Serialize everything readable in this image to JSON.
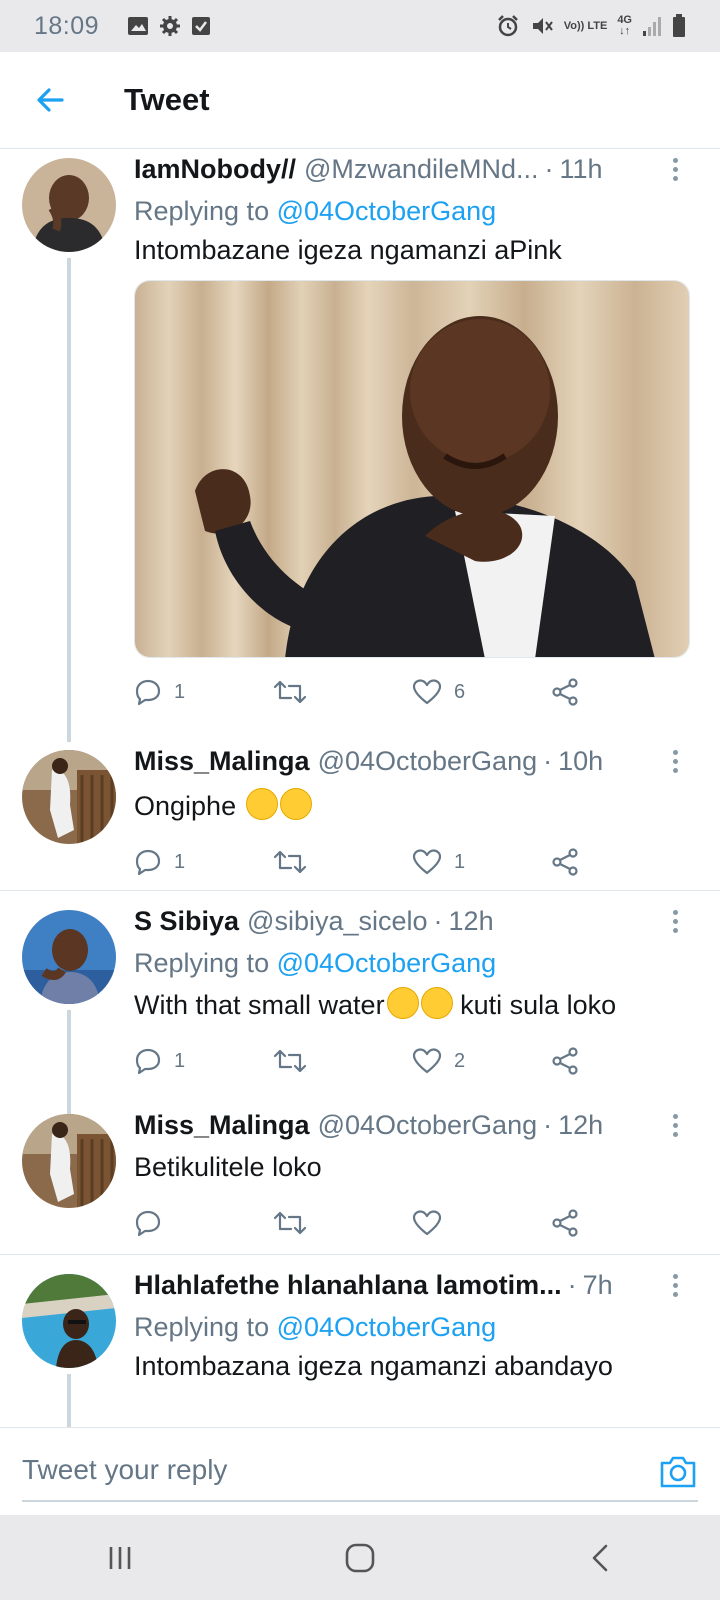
{
  "status_bar": {
    "time": "18:09",
    "left_icons": [
      "image-icon",
      "gear-icon",
      "check-box-icon"
    ],
    "right_icons": [
      "alarm-icon",
      "mute-icon",
      "volte-icon",
      "4g-icon",
      "signal-icon",
      "battery-icon"
    ],
    "volte_label": "Vo)) LTE",
    "network_label": "4G"
  },
  "header": {
    "title": "Tweet",
    "back_icon": "arrow-left-icon"
  },
  "tweets": [
    {
      "name": "IamNobody//",
      "handle": "@MzwandileMNd...",
      "time": "11h",
      "replying_prefix": "Replying to",
      "replying_to": "@04OctoberGang",
      "text": "Intombazane igeza ngamanzi aPink",
      "has_media": true,
      "reply_count": "1",
      "like_count": "6"
    },
    {
      "name": "Miss_Malinga",
      "handle": "@04OctoberGang",
      "time": "10h",
      "text": "Ongiphe",
      "emojis": [
        "face-with-tears-of-joy",
        "face-with-tears-of-joy"
      ],
      "reply_count": "1",
      "like_count": "1"
    },
    {
      "name": "S Sibiya",
      "handle": "@sibiya_sicelo",
      "time": "12h",
      "replying_prefix": "Replying to",
      "replying_to": "@04OctoberGang",
      "text": "With that small water",
      "emojis": [
        "face-with-rolling-eyes",
        "face-with-rolling-eyes"
      ],
      "text_after": "kuti sula loko",
      "reply_count": "1",
      "like_count": "2"
    },
    {
      "name": "Miss_Malinga",
      "handle": "@04OctoberGang",
      "time": "12h",
      "text": "Betikulitele loko",
      "reply_count": "",
      "like_count": ""
    },
    {
      "name": "Hlahlafethe hlanahlana lamotim...",
      "handle": "",
      "time": "7h",
      "replying_prefix": "Replying to",
      "replying_to": "@04OctoberGang",
      "text": "Intombazana igeza ngamanzi abandayo"
    }
  ],
  "reply_bar": {
    "placeholder": "Tweet your reply",
    "camera_icon": "camera-icon"
  },
  "nav_bar": {
    "buttons": [
      "recent-apps-icon",
      "home-icon",
      "back-icon"
    ]
  },
  "colors": {
    "accent": "#1da1f2",
    "text_primary": "#14171a",
    "text_secondary": "#657786",
    "divider": "#e1e8ed",
    "thread_line": "#ccd6dd",
    "system_bar": "#e9e9ec"
  }
}
